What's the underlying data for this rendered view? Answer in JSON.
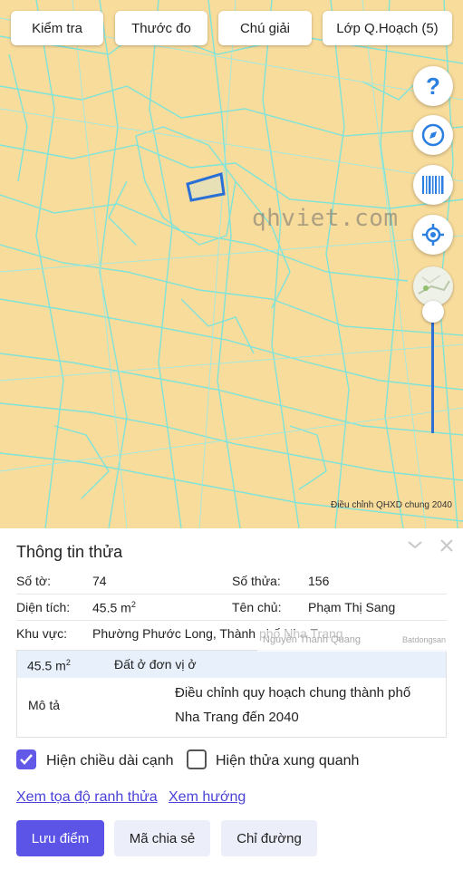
{
  "toolbar": {
    "check": "Kiểm tra",
    "measure": "Thước đo",
    "legend": "Chú giải",
    "planning_layer": "Lớp Q.Hoạch (5)"
  },
  "map": {
    "watermark": "qhviet.com",
    "caption": "Điều chỉnh QHXD chung 2040",
    "icons": [
      "help-icon",
      "compass-icon",
      "barcode-icon",
      "locate-icon"
    ]
  },
  "panel": {
    "title": "Thông tin thửa",
    "sheet_label": "Số tờ:",
    "sheet_value": "74",
    "parcel_label": "Số thửa:",
    "parcel_value": "156",
    "area_label": "Diện tích:",
    "area_value": "45.5 m",
    "area_sup": "2",
    "owner_label": "Tên chủ:",
    "owner_value": "Phạm Thị Sang",
    "region_label": "Khu vực:",
    "region_value": "Phường Phước Long, Thành phố Nha Trang",
    "overlay_name": "Nguyễn Thanh Quang",
    "overlay_brand": "Batdongsan"
  },
  "table": {
    "area": "45.5 m",
    "area_sup": "2",
    "land_type": "Đất ở đơn vị ở",
    "desc_label": "Mô tả",
    "desc_value_line1": "Điều chỉnh quy hoạch chung thành phố",
    "desc_value_line2": "Nha Trang đến 2040"
  },
  "options": {
    "show_edge_length": "Hiện chiều dài cạnh",
    "show_edge_length_checked": true,
    "show_neighbors": "Hiện thửa xung quanh",
    "show_neighbors_checked": false
  },
  "links": {
    "boundary_coords": "Xem tọa độ ranh thửa",
    "direction": "Xem hướng"
  },
  "buttons": {
    "save_point": "Lưu điểm",
    "share_code": "Mã chia sẻ",
    "directions": "Chỉ đường"
  },
  "colors": {
    "map_bg": "#f8dc9c",
    "parcel_line": "#7fe3d8",
    "highlight": "#2a6fd6",
    "accent": "#5b54e6",
    "link": "#4a42d8"
  }
}
